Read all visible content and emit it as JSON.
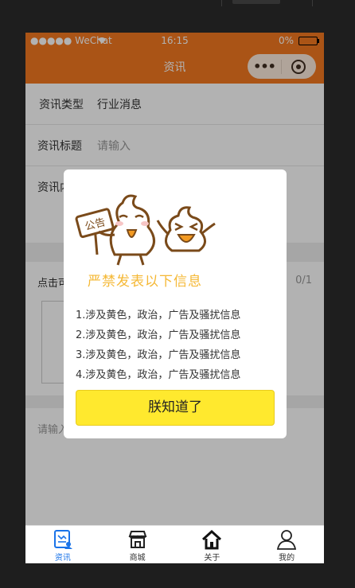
{
  "status_bar": {
    "carrier": "●●●●● WeChat",
    "time": "16:15",
    "battery": "0%"
  },
  "nav": {
    "title": "资讯",
    "menu_dots": "•••"
  },
  "form": {
    "type_label": "资讯类型",
    "type_value": "行业消息",
    "title_label": "资讯标题",
    "title_placeholder": "请输入",
    "content_label": "资讯内容",
    "upload_label": "点击可上传图片",
    "upload_count": "0/1",
    "remark_placeholder": "请输入"
  },
  "modal": {
    "sign_text": "公告",
    "title": "严禁发表以下信息",
    "items": [
      "1.涉及黄色，政治，广告及骚扰信息",
      "2.涉及黄色，政治，广告及骚扰信息",
      "3.涉及黄色，政治，广告及骚扰信息",
      "4.涉及黄色，政治，广告及骚扰信息"
    ],
    "confirm_label": "朕知道了"
  },
  "tabbar": {
    "items": [
      {
        "label": "资讯",
        "icon": "news-icon",
        "active": true
      },
      {
        "label": "商城",
        "icon": "store-icon",
        "active": false
      },
      {
        "label": "关于",
        "icon": "home-icon",
        "active": false
      },
      {
        "label": "我的",
        "icon": "user-icon",
        "active": false
      }
    ]
  },
  "colors": {
    "nav_orange": "#f47920",
    "modal_title": "#f5b835",
    "confirm_button": "#ffe92e",
    "active_tab": "#1a73e8"
  }
}
